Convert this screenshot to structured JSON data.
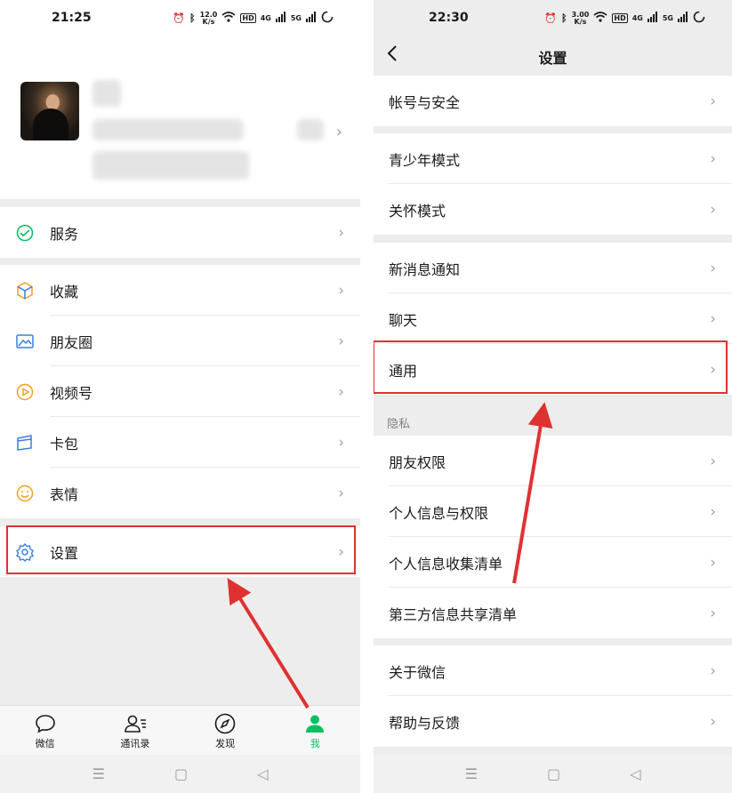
{
  "left": {
    "status_bar": {
      "time": "21:25",
      "speed": "12.0",
      "speed_unit": "K/s",
      "hd": "HD",
      "net1": "4G",
      "net2": "5G"
    },
    "menu": {
      "services": "服务",
      "favorites": "收藏",
      "moments": "朋友圈",
      "channels": "视频号",
      "cards": "卡包",
      "stickers": "表情",
      "settings": "设置"
    },
    "tabs": {
      "chats": "微信",
      "contacts": "通讯录",
      "discover": "发现",
      "me": "我"
    }
  },
  "right": {
    "status_bar": {
      "time": "22:30",
      "speed": "3.00",
      "speed_unit": "K/s",
      "hd": "HD",
      "net1": "4G",
      "net2": "5G"
    },
    "title": "设置",
    "items": {
      "account_security": "帐号与安全",
      "teen_mode": "青少年模式",
      "care_mode": "关怀模式",
      "new_message_notify": "新消息通知",
      "chat": "聊天",
      "general": "通用",
      "privacy_header": "隐私",
      "friend_permissions": "朋友权限",
      "personal_info_permissions": "个人信息与权限",
      "personal_info_collection": "个人信息收集清单",
      "third_party_sharing": "第三方信息共享清单",
      "about_wechat": "关于微信",
      "help_feedback": "帮助与反馈"
    }
  },
  "colors": {
    "accent_green": "#07c160",
    "highlight_red": "#e03131",
    "background_gray": "#ededed"
  },
  "icons": {
    "chevron": "›",
    "back": "chevron-left-icon",
    "nav_menu": "☰",
    "nav_home": "▢",
    "nav_back": "◁"
  }
}
